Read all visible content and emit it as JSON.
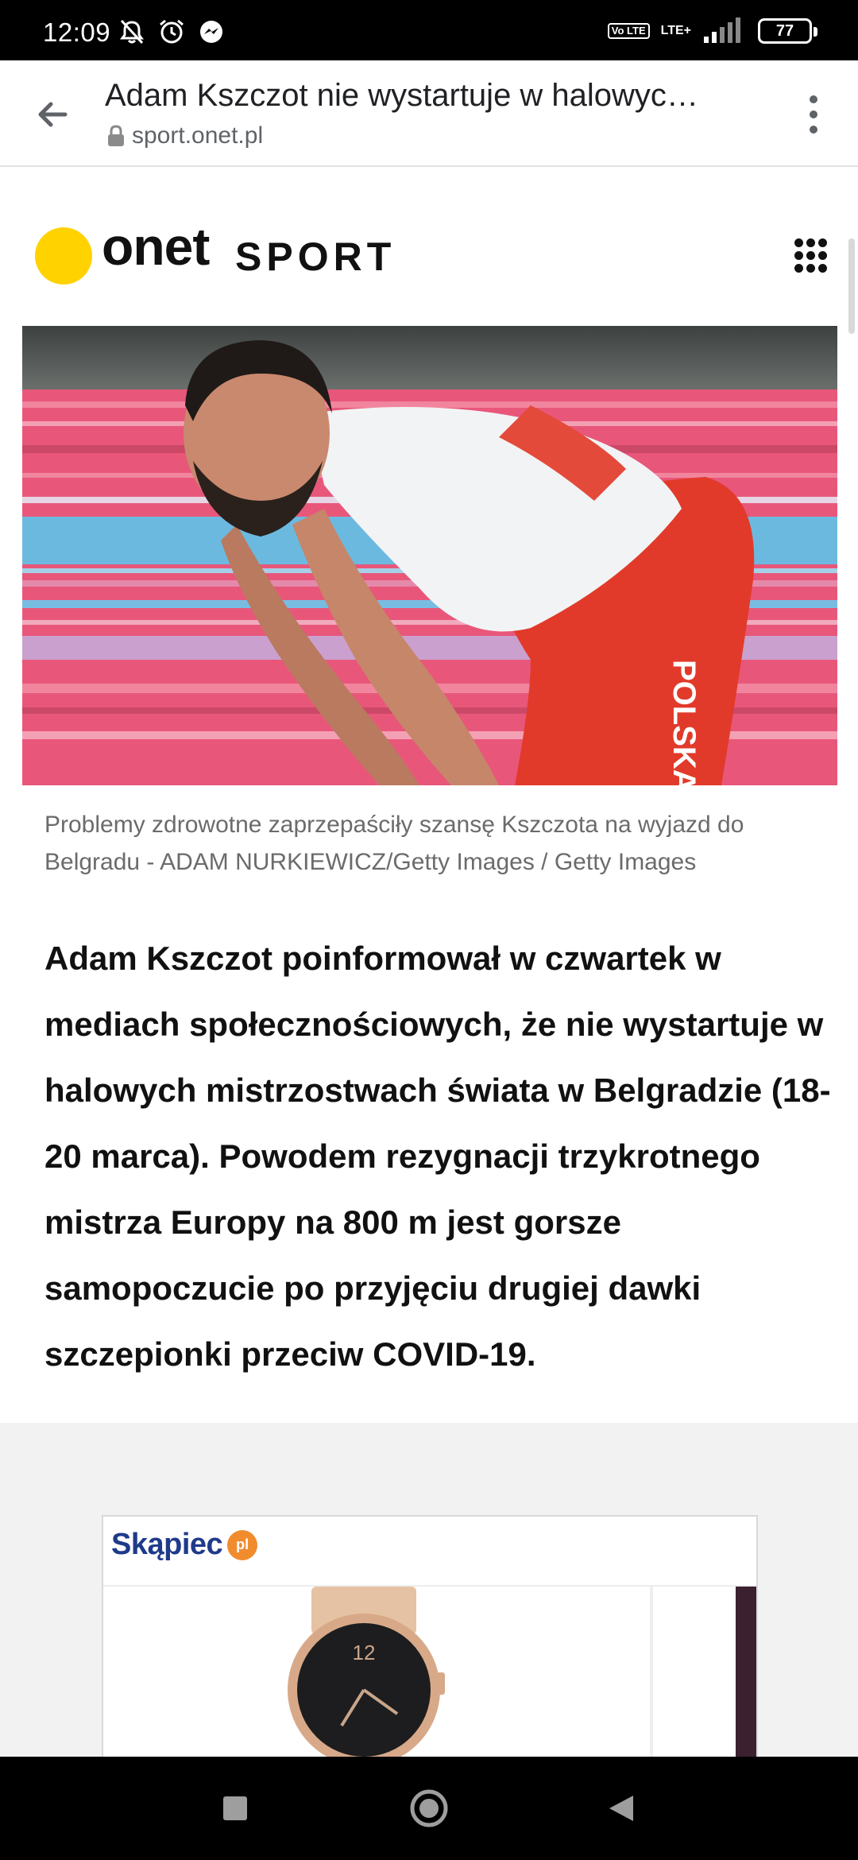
{
  "status_bar": {
    "time": "12:09",
    "network_badge": "Vo LTE",
    "network_type": "LTE+",
    "battery": "77"
  },
  "browser": {
    "title": "Adam Kszczot nie wystartuje w halowych mistrzostwach świata",
    "url": "sport.onet.pl"
  },
  "site": {
    "logo_primary": "onet",
    "logo_secondary": "SPORT",
    "accent_color": "#ffd200"
  },
  "article": {
    "caption": "Problemy zdrowotne zaprzepaściły szansę Kszczota na wyjazd do Belgradu - ADAM NURKIEWICZ/Getty Images / Getty Images",
    "lead": "Adam Kszczot poinformował w czwartek w mediach społecznościowych, że nie wystartuje w halowych mistrzostwach świata w Belgradzie (18-20 marca). Powodem rezygnacji trzykrotnego mistrza Europy na 800 m jest gorsze samopoczucie po przyjęciu drugiej dawki szczepionki przeciw COVID-19.",
    "photo_text": {
      "shirt_print": "POLSKA",
      "watch_numeral": "12"
    }
  },
  "ad": {
    "brand": "Skąpiec",
    "badge": "pl"
  },
  "icons": {
    "back": "arrow-left-icon",
    "lock": "lock-icon",
    "menu": "more-vert-icon",
    "apps": "apps-grid-icon",
    "nav_recents": "square-icon",
    "nav_home": "circle-icon",
    "nav_back": "triangle-back-icon"
  }
}
